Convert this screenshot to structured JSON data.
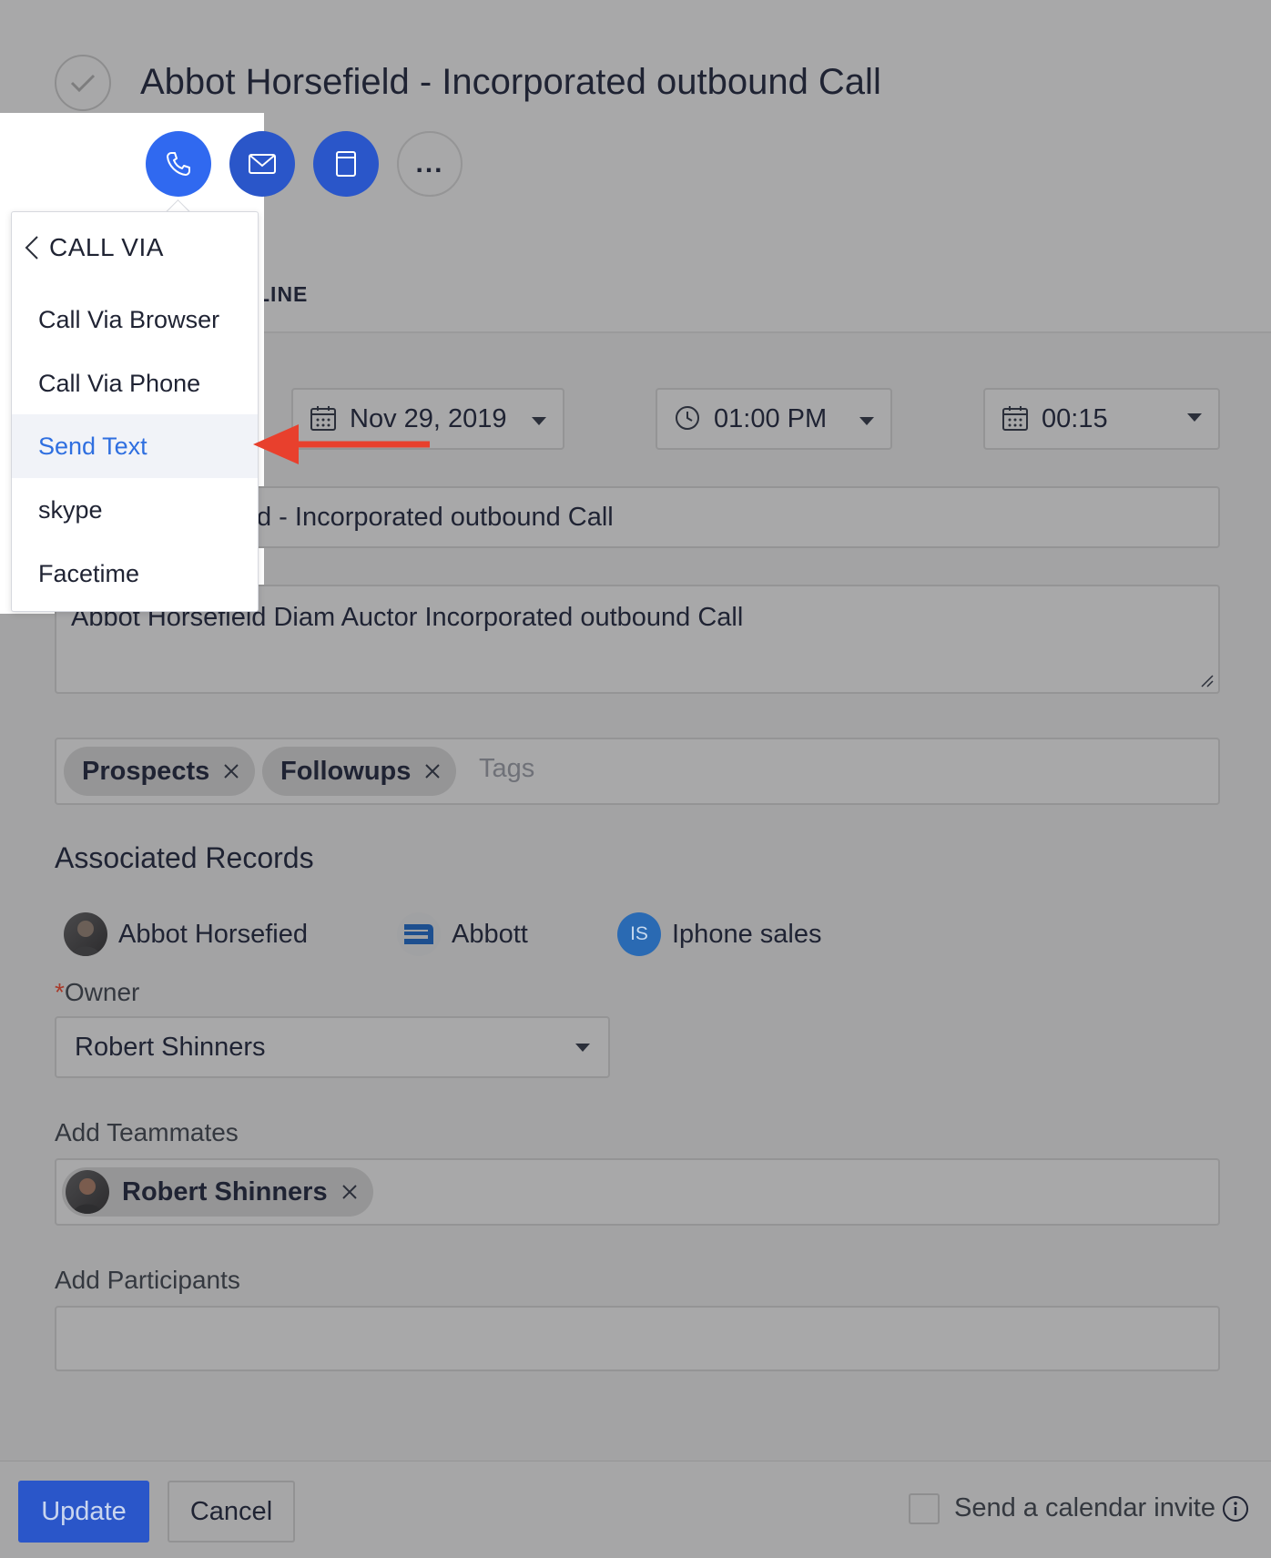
{
  "title": "Abbot Horsefield - Incorporated outbound Call",
  "actions": {
    "phone_icon": "phone-icon",
    "mail_icon": "mail-icon",
    "note_icon": "note-icon",
    "more_label": "..."
  },
  "tab": {
    "label": "LINE"
  },
  "dropdown": {
    "header": "CALL VIA",
    "items": [
      "Call Via Browser",
      "Call Via Phone",
      "Send Text",
      "skype",
      "Facetime"
    ],
    "active_item": "Send Text"
  },
  "schedule": {
    "date": "Nov 29, 2019",
    "time": "01:00 PM",
    "duration": "00:15"
  },
  "subject": {
    "visible_value": "d - Incorporated outbound Call"
  },
  "description": {
    "visible_value": "Abbot Horsefield Diam Auctor Incorporated outbound Call"
  },
  "tags": {
    "chips": [
      "Prospects",
      "Followups"
    ],
    "placeholder": "Tags"
  },
  "associated": {
    "heading": "Associated Records",
    "records": [
      {
        "name": "Abbot Horsefied",
        "type": "person"
      },
      {
        "name": "Abbott",
        "type": "company"
      },
      {
        "name": "Iphone sales",
        "type": "deal",
        "initials": "IS"
      }
    ]
  },
  "owner": {
    "required_mark": "*",
    "label": "Owner",
    "value": "Robert Shinners"
  },
  "teammates": {
    "label": "Add Teammates",
    "chips": [
      "Robert Shinners"
    ]
  },
  "participants": {
    "label": "Add Participants",
    "value": ""
  },
  "footer": {
    "update_label": "Update",
    "cancel_label": "Cancel",
    "calendar_invite_label": "Send a calendar invite"
  },
  "colors": {
    "primary": "#3069f0",
    "primary_dark": "#2a56c9",
    "arrow": "#e8402d",
    "active_text": "#2f6fe0"
  }
}
